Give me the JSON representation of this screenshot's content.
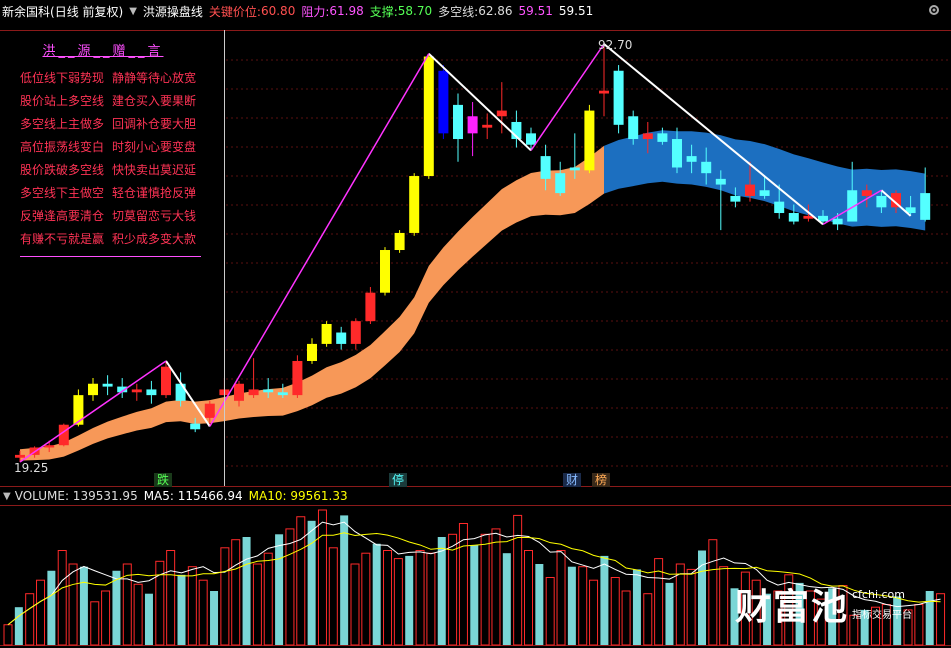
{
  "header": {
    "stock_name": "新余国科",
    "period": "(日线 前复权)",
    "indicator_name": "洪源操盘线",
    "key_price_label": "关键价位:",
    "key_price_value": "60.80",
    "resistance_label": "阻力:",
    "resistance_value": "61.98",
    "support_label": "支撑:",
    "support_value": "58.70",
    "dkx_label": "多空线:",
    "dkx_value": "62.86",
    "val_a": "59.51",
    "val_b": "59.51"
  },
  "legend": {
    "title": "洪__源__赠__言",
    "rows": [
      [
        "低位线下弱势现",
        "静静等待心放宽"
      ],
      [
        "股价站上多空线",
        "建仓买入要果断"
      ],
      [
        "多空线上主做多",
        "回调补仓要大胆"
      ],
      [
        "高位振荡线变白",
        "时刻小心要变盘"
      ],
      [
        "股价跌破多空线",
        "快快卖出莫迟延"
      ],
      [
        "多空线下主做空",
        "轻仓谨慎抢反弹"
      ],
      [
        "反弹逢高要清仓",
        "切莫留恋亏大钱"
      ],
      [
        "有赚不亏就是赢",
        "积少成多变大款"
      ]
    ]
  },
  "price_labels": {
    "high": "92.70",
    "low": "19.25"
  },
  "event_tags": {
    "die": "跌",
    "ting": "停",
    "cai": "财",
    "bang": "榜"
  },
  "volume_header": {
    "label": "VOLUME: 139531.95",
    "ma5": "MA5: 115466.94",
    "ma10": "MA10: 99561.33"
  },
  "watermark": {
    "brand": "财富池",
    "site": "cfchi.com",
    "sub": "指标交易平台"
  },
  "colors": {
    "up": "#ff2a2a",
    "down": "#54ffff",
    "yellow_block": "#ffff00",
    "magenta_block": "#ff22ff",
    "blue_block": "#0000ff",
    "ma_band": "#f79858",
    "ma_band_blue": "#1c6fc0",
    "ma5": "#ffffff",
    "ma10": "#ffff00"
  },
  "chart_data": {
    "type": "candlestick",
    "ylim": [
      19.25,
      92.7
    ],
    "candles": [
      {
        "o": 20.0,
        "h": 21.2,
        "l": 19.25,
        "c": 20.5
      },
      {
        "o": 20.5,
        "h": 22.0,
        "l": 20.0,
        "c": 21.8
      },
      {
        "o": 21.8,
        "h": 23.0,
        "l": 21.0,
        "c": 22.2
      },
      {
        "o": 22.2,
        "h": 26.0,
        "l": 22.0,
        "c": 25.8
      },
      {
        "o": 25.8,
        "h": 32.0,
        "l": 25.5,
        "c": 31.0
      },
      {
        "o": 31.0,
        "h": 34.0,
        "l": 30.0,
        "c": 33.0
      },
      {
        "o": 33.0,
        "h": 34.5,
        "l": 31.0,
        "c": 32.5
      },
      {
        "o": 32.5,
        "h": 34.0,
        "l": 30.5,
        "c": 31.5
      },
      {
        "o": 31.5,
        "h": 33.0,
        "l": 30.0,
        "c": 32.0
      },
      {
        "o": 32.0,
        "h": 33.5,
        "l": 29.5,
        "c": 31.0
      },
      {
        "o": 31.0,
        "h": 37.0,
        "l": 30.5,
        "c": 36.0
      },
      {
        "o": 33.0,
        "h": 35.0,
        "l": 29.0,
        "c": 30.0
      },
      {
        "o": 26.0,
        "h": 27.0,
        "l": 24.5,
        "c": 25.0
      },
      {
        "o": 27.0,
        "h": 30.0,
        "l": 25.5,
        "c": 29.5
      },
      {
        "o": 31.0,
        "h": 34.0,
        "l": 30.0,
        "c": 32.0
      },
      {
        "o": 30.0,
        "h": 33.5,
        "l": 29.0,
        "c": 33.0
      },
      {
        "o": 31.0,
        "h": 37.5,
        "l": 30.5,
        "c": 32.0
      },
      {
        "o": 32.0,
        "h": 34.0,
        "l": 30.5,
        "c": 31.5
      },
      {
        "o": 31.5,
        "h": 33.0,
        "l": 30.5,
        "c": 31.0
      },
      {
        "o": 31.0,
        "h": 38.0,
        "l": 30.5,
        "c": 37.0
      },
      {
        "o": 37.0,
        "h": 41.0,
        "l": 36.5,
        "c": 40.0
      },
      {
        "o": 40.0,
        "h": 44.0,
        "l": 39.5,
        "c": 43.5
      },
      {
        "o": 42.0,
        "h": 43.0,
        "l": 39.0,
        "c": 40.0
      },
      {
        "o": 40.0,
        "h": 44.5,
        "l": 39.0,
        "c": 44.0
      },
      {
        "o": 44.0,
        "h": 50.0,
        "l": 43.5,
        "c": 49.0
      },
      {
        "o": 49.0,
        "h": 57.0,
        "l": 48.5,
        "c": 56.5
      },
      {
        "o": 56.5,
        "h": 60.0,
        "l": 56.0,
        "c": 59.5
      },
      {
        "o": 59.5,
        "h": 70.0,
        "l": 59.0,
        "c": 69.5
      },
      {
        "o": 69.5,
        "h": 91.0,
        "l": 69.0,
        "c": 90.5
      },
      {
        "o": 88.0,
        "h": 89.0,
        "l": 76.0,
        "c": 77.0
      },
      {
        "o": 82.0,
        "h": 84.0,
        "l": 72.0,
        "c": 76.0
      },
      {
        "o": 80.0,
        "h": 82.5,
        "l": 73.0,
        "c": 77.0
      },
      {
        "o": 78.0,
        "h": 80.5,
        "l": 76.0,
        "c": 78.5
      },
      {
        "o": 80.0,
        "h": 86.0,
        "l": 77.0,
        "c": 81.0
      },
      {
        "o": 79.0,
        "h": 81.0,
        "l": 74.5,
        "c": 76.0
      },
      {
        "o": 77.0,
        "h": 78.0,
        "l": 74.0,
        "c": 75.0
      },
      {
        "o": 73.0,
        "h": 75.0,
        "l": 67.0,
        "c": 69.0
      },
      {
        "o": 70.0,
        "h": 72.0,
        "l": 66.0,
        "c": 66.5
      },
      {
        "o": 71.0,
        "h": 77.0,
        "l": 69.0,
        "c": 70.5
      },
      {
        "o": 70.5,
        "h": 82.0,
        "l": 70.0,
        "c": 81.0
      },
      {
        "o": 84.0,
        "h": 92.7,
        "l": 80.0,
        "c": 84.5
      },
      {
        "o": 88.0,
        "h": 89.0,
        "l": 77.0,
        "c": 78.5
      },
      {
        "o": 80.0,
        "h": 81.0,
        "l": 75.0,
        "c": 76.0
      },
      {
        "o": 76.0,
        "h": 79.0,
        "l": 73.5,
        "c": 77.0
      },
      {
        "o": 77.0,
        "h": 78.0,
        "l": 75.0,
        "c": 75.5
      },
      {
        "o": 76.0,
        "h": 78.0,
        "l": 70.0,
        "c": 71.0
      },
      {
        "o": 73.0,
        "h": 75.0,
        "l": 70.0,
        "c": 72.0
      },
      {
        "o": 72.0,
        "h": 74.5,
        "l": 68.0,
        "c": 70.0
      },
      {
        "o": 69.0,
        "h": 70.5,
        "l": 60.0,
        "c": 68.0
      },
      {
        "o": 66.0,
        "h": 67.5,
        "l": 64.0,
        "c": 65.0
      },
      {
        "o": 66.0,
        "h": 72.0,
        "l": 65.0,
        "c": 68.0
      },
      {
        "o": 67.0,
        "h": 69.5,
        "l": 65.5,
        "c": 66.0
      },
      {
        "o": 65.0,
        "h": 68.0,
        "l": 62.0,
        "c": 63.0
      },
      {
        "o": 63.0,
        "h": 64.5,
        "l": 61.0,
        "c": 61.5
      },
      {
        "o": 62.0,
        "h": 64.5,
        "l": 61.5,
        "c": 62.5
      },
      {
        "o": 62.5,
        "h": 63.5,
        "l": 61.0,
        "c": 61.5
      },
      {
        "o": 62.0,
        "h": 63.0,
        "l": 60.0,
        "c": 61.0
      },
      {
        "o": 67.0,
        "h": 72.0,
        "l": 62.5,
        "c": 61.5
      },
      {
        "o": 66.0,
        "h": 68.0,
        "l": 64.0,
        "c": 67.0
      },
      {
        "o": 66.0,
        "h": 67.0,
        "l": 63.0,
        "c": 64.0
      },
      {
        "o": 64.0,
        "h": 67.0,
        "l": 63.0,
        "c": 66.5
      },
      {
        "o": 64.0,
        "h": 66.0,
        "l": 62.5,
        "c": 63.0
      },
      {
        "o": 66.5,
        "h": 71.0,
        "l": 61.5,
        "c": 61.8
      }
    ],
    "volume": [
      15,
      28,
      38,
      48,
      55,
      70,
      60,
      58,
      32,
      40,
      55,
      60,
      45,
      38,
      62,
      70,
      52,
      58,
      48,
      40,
      72,
      78,
      80,
      60,
      68,
      82,
      86,
      95,
      92,
      100,
      72,
      96,
      60,
      68,
      75,
      70,
      64,
      66,
      70,
      68,
      80,
      82,
      90,
      74,
      82,
      86,
      68,
      96,
      70,
      60,
      50,
      70,
      58,
      58,
      48,
      66,
      50,
      40,
      56,
      38,
      64,
      46,
      60,
      56,
      70,
      78,
      58,
      42,
      54,
      48,
      38,
      40,
      52,
      46,
      40,
      34,
      42,
      44,
      22,
      26,
      28,
      30,
      36,
      26,
      30,
      40,
      38
    ]
  }
}
